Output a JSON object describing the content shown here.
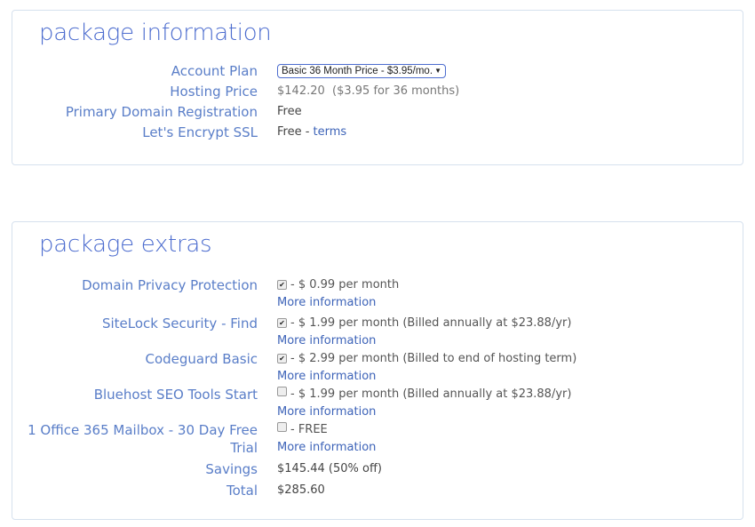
{
  "info": {
    "title": "package information",
    "account_plan_label": "Account Plan",
    "account_plan_value": "Basic 36 Month Price - $3.95/mo.",
    "hosting_price_label": "Hosting Price",
    "hosting_price_value": "$142.20",
    "hosting_price_note": "($3.95 for 36 months)",
    "domain_label": "Primary Domain Registration",
    "domain_value": "Free",
    "ssl_label": "Let's Encrypt SSL",
    "ssl_value": "Free - ",
    "ssl_link": "terms"
  },
  "extras": {
    "title": "package extras",
    "items": [
      {
        "label": "Domain Privacy Protection",
        "checked": true,
        "price": "- $ 0.99 per month",
        "more": "More information"
      },
      {
        "label": "SiteLock Security - Find",
        "checked": true,
        "price": "- $ 1.99 per month (Billed annually at $23.88/yr)",
        "more": "More information"
      },
      {
        "label": "Codeguard Basic",
        "checked": true,
        "price": "- $ 2.99 per month (Billed to end of hosting term)",
        "more": "More information"
      },
      {
        "label": "Bluehost SEO Tools Start",
        "checked": false,
        "price": "- $ 1.99 per month (Billed annually at $23.88/yr)",
        "more": "More information"
      },
      {
        "label": "1 Office 365 Mailbox - 30 Day Free Trial",
        "checked": false,
        "price": "- FREE",
        "more": "More information"
      }
    ],
    "savings_label": "Savings",
    "savings_value": "$145.44 (50% off)",
    "total_label": "Total",
    "total_value": "$285.60"
  }
}
